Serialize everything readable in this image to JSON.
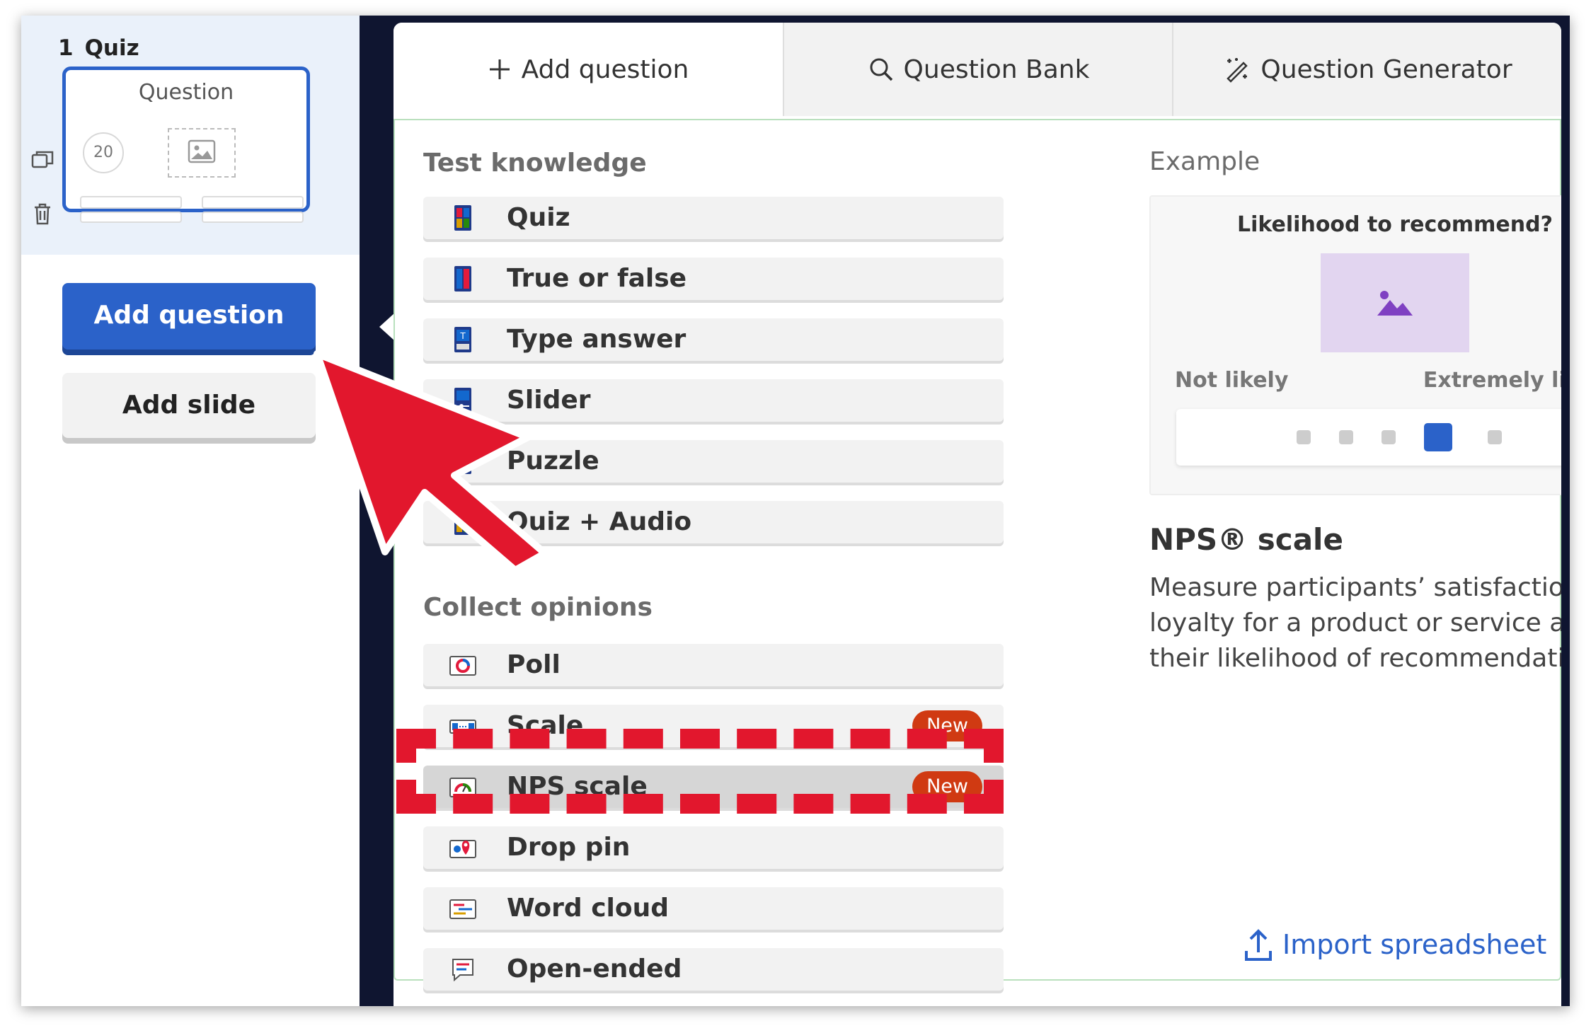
{
  "sidebar": {
    "slide": {
      "number": "1",
      "type_label": "Quiz",
      "thumbnail_title": "Question",
      "thumbnail_timer": "20"
    },
    "add_question_label": "Add question",
    "add_slide_label": "Add slide"
  },
  "tabs": [
    {
      "label": "Add question",
      "icon": "plus-icon",
      "active": true
    },
    {
      "label": "Question Bank",
      "icon": "search-icon",
      "active": false
    },
    {
      "label": "Question Generator",
      "icon": "magic-wand-icon",
      "active": false
    }
  ],
  "test_knowledge": {
    "title": "Test knowledge",
    "items": [
      {
        "label": "Quiz",
        "icon": "quiz-icon"
      },
      {
        "label": "True or false",
        "icon": "true-false-icon"
      },
      {
        "label": "Type answer",
        "icon": "type-answer-icon"
      },
      {
        "label": "Slider",
        "icon": "slider-icon"
      },
      {
        "label": "Puzzle",
        "icon": "puzzle-icon"
      },
      {
        "label": "Quiz + Audio",
        "icon": "quiz-audio-icon"
      }
    ]
  },
  "collect_opinions": {
    "title": "Collect opinions",
    "items": [
      {
        "label": "Poll",
        "icon": "poll-icon"
      },
      {
        "label": "Scale",
        "icon": "scale-icon",
        "badge": "New"
      },
      {
        "label": "NPS scale",
        "icon": "nps-scale-icon",
        "badge": "New",
        "selected": true
      },
      {
        "label": "Drop pin",
        "icon": "drop-pin-icon"
      },
      {
        "label": "Word cloud",
        "icon": "word-cloud-icon"
      },
      {
        "label": "Open-ended",
        "icon": "open-ended-icon"
      }
    ]
  },
  "example": {
    "title": "Example",
    "question": "Likelihood to recommend?",
    "low_label": "Not likely",
    "high_label": "Extremely likely",
    "selected_point": 4,
    "total_points": 5
  },
  "description": {
    "title": "NPS® scale",
    "body": "Measure participants’ satisfaction and loyalty for a product or service and their likelihood of recommendation."
  },
  "import_label": "Import spreadsheet",
  "colors": {
    "primary": "#2b62c9",
    "badge": "#d03a12",
    "annotation": "#e2172d",
    "backdrop": "#0f1530"
  }
}
